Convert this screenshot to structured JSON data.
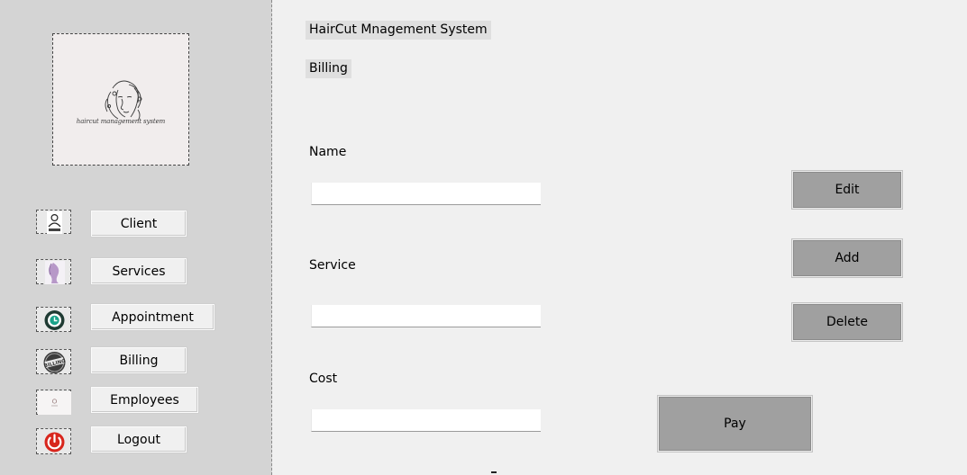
{
  "app": {
    "title": "HairCut Mnagement System",
    "section": "Billing"
  },
  "sidebar": {
    "logo_text": "haircut management system",
    "items": [
      {
        "label": "Client",
        "icon": "client-icon"
      },
      {
        "label": "Services",
        "icon": "services-icon"
      },
      {
        "label": "Appointment",
        "icon": "appointment-clock-icon"
      },
      {
        "label": "Billing",
        "icon": "billing-icon"
      },
      {
        "label": "Employees",
        "icon": "employees-icon"
      },
      {
        "label": "Logout",
        "icon": "power-icon"
      }
    ]
  },
  "form": {
    "name_label": "Name",
    "name_value": "",
    "service_label": "Service",
    "service_value": "",
    "cost_label": "Cost",
    "cost_value": ""
  },
  "actions": {
    "edit": "Edit",
    "add": "Add",
    "delete": "Delete",
    "pay": "Pay"
  },
  "colors": {
    "sidebar_bg": "#d4d4d4",
    "main_bg": "#f0f0f0",
    "action_button_bg": "#a0a0a0",
    "logout_red": "#d8261d"
  }
}
